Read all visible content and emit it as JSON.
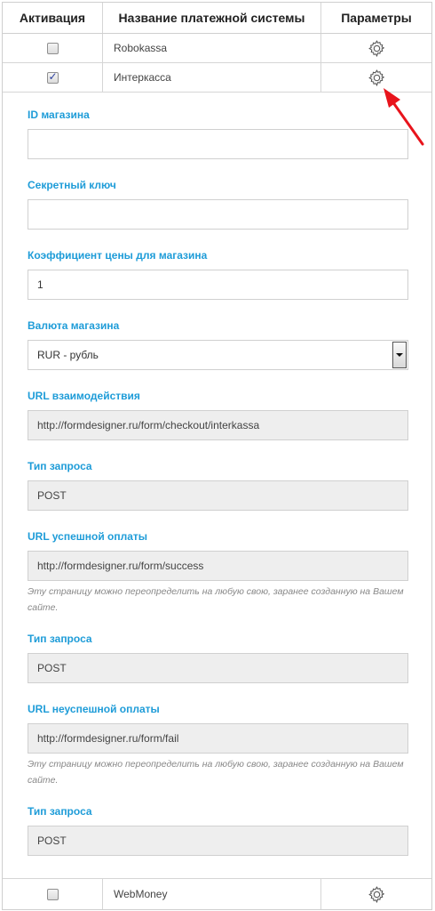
{
  "table": {
    "headers": {
      "activation": "Активация",
      "name": "Название платежной системы",
      "params": "Параметры"
    },
    "rows": [
      {
        "name": "Robokassa",
        "checked": false
      },
      {
        "name": "Интеркасса",
        "checked": true
      },
      {
        "name": "WebMoney",
        "checked": false
      }
    ]
  },
  "settings": {
    "shop_id": {
      "label": "ID магазина",
      "value": ""
    },
    "secret_key": {
      "label": "Секретный ключ",
      "value": ""
    },
    "price_coef": {
      "label": "Коэффициент цены для магазина",
      "value": "1"
    },
    "currency": {
      "label": "Валюта магазина",
      "value": "RUR - рубль"
    },
    "interaction_url": {
      "label": "URL взаимодействия",
      "value": "http://formdesigner.ru/form/checkout/interkassa"
    },
    "request_type_1": {
      "label": "Тип запроса",
      "value": "POST"
    },
    "success_url": {
      "label": "URL успешной оплаты",
      "value": "http://formdesigner.ru/form/success",
      "note": "Эту страницу можно переопределить на любую свою, заранее созданную на Вашем сайте."
    },
    "request_type_2": {
      "label": "Тип запроса",
      "value": "POST"
    },
    "fail_url": {
      "label": "URL неуспешной оплаты",
      "value": "http://formdesigner.ru/form/fail",
      "note": "Эту страницу можно переопределить на любую свою, заранее созданную на Вашем сайте."
    },
    "request_type_3": {
      "label": "Тип запроса",
      "value": "POST"
    }
  },
  "icons": {
    "gear": "gear-icon",
    "arrow": "red-arrow-annotation"
  },
  "colors": {
    "label": "#1e9cd8",
    "arrow": "#e8141c",
    "readonly_bg": "#eeeeee"
  }
}
